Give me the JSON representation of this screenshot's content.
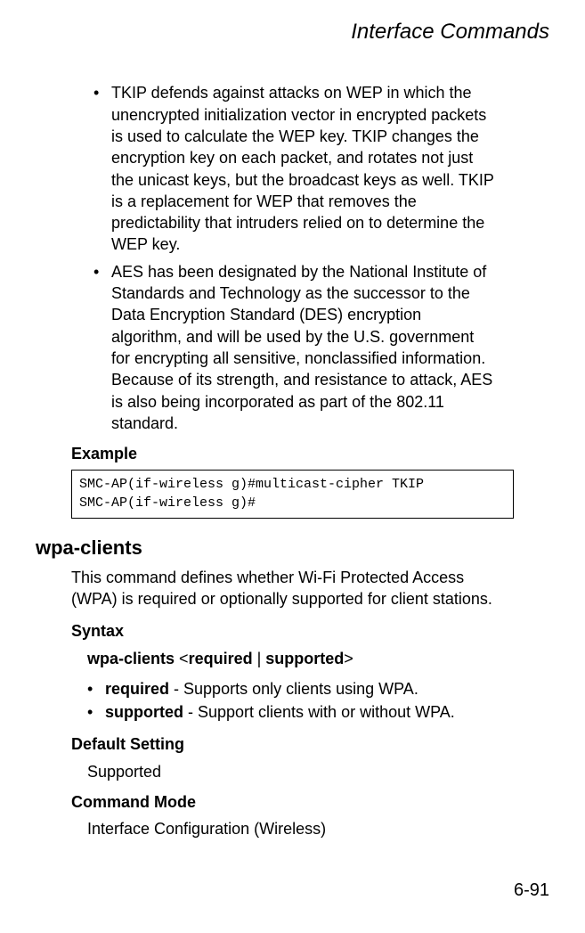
{
  "header": {
    "title": "Interface Commands"
  },
  "bullets": [
    "TKIP defends against attacks on WEP in which the unencrypted initialization vector in encrypted packets is used to calculate the WEP key. TKIP changes the encryption key on each packet, and rotates not just the unicast keys, but the broadcast keys as well. TKIP is a replacement for WEP that removes the predictability that intruders relied on to determine the WEP key.",
    "AES has been designated by the National Institute of Standards and Technology as the successor to the Data Encryption Standard (DES) encryption algorithm, and will be used by the U.S. government for encrypting all sensitive, nonclassified information. Because of its strength, and resistance to attack, AES is also being incorporated as part of the 802.11 standard."
  ],
  "example": {
    "label": "Example",
    "code": "SMC-AP(if-wireless g)#multicast-cipher TKIP\nSMC-AP(if-wireless g)#"
  },
  "command": {
    "name": "wpa-clients",
    "description": "This command defines whether Wi-Fi Protected Access (WPA) is required or optionally supported for client stations.",
    "syntax_label": "Syntax",
    "syntax_cmd": "wpa-clients",
    "syntax_lt": "<",
    "syntax_opt1": "required",
    "syntax_sep": " | ",
    "syntax_opt2": "supported",
    "syntax_gt": ">",
    "options": [
      {
        "name": "required",
        "desc": " - Supports only clients using WPA."
      },
      {
        "name": "supported",
        "desc": " - Support clients with or without WPA."
      }
    ],
    "default_label": "Default Setting",
    "default_value": "Supported",
    "mode_label": "Command Mode",
    "mode_value": "Interface Configuration (Wireless)"
  },
  "page_number": "6-91"
}
